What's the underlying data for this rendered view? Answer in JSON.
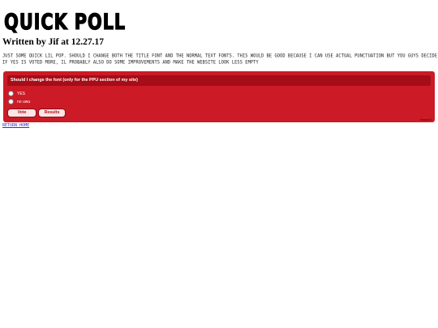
{
  "header": {
    "logo_text": "QUICK POLL"
  },
  "byline": "Written by Jif at 12.27.17",
  "intro": {
    "line1": "JUST SOME QUICK LIL POP. SHOULD I CHANGE BOTH THE TITLE FONT AND THE NORMAL TEXT FONTS. THIS WOULD BE GOOD BECAUSE I CAN USE ACTUAL PUNCTUATION BUT YOU GUYS DECIDE",
    "line2": "IF YES IS VOTED MORE, IL PROBABLY ALSO DO SOME IMPROVEMENTS AND MAKE THE WEBSITE LOOK LESS EMPTY"
  },
  "poll": {
    "question": "Should I change the font (only for the PPU section of my site)",
    "options": [
      {
        "label": "YES"
      },
      {
        "label": "no uwu"
      }
    ],
    "vote_label": "Vote",
    "results_label": "Results",
    "credit": "strawpoll"
  },
  "footer": {
    "return_link": "RETURN HOME"
  },
  "colors": {
    "poll_background": "#cc1a26",
    "question_bar": "#a50d17",
    "link": "#2b36c8"
  }
}
